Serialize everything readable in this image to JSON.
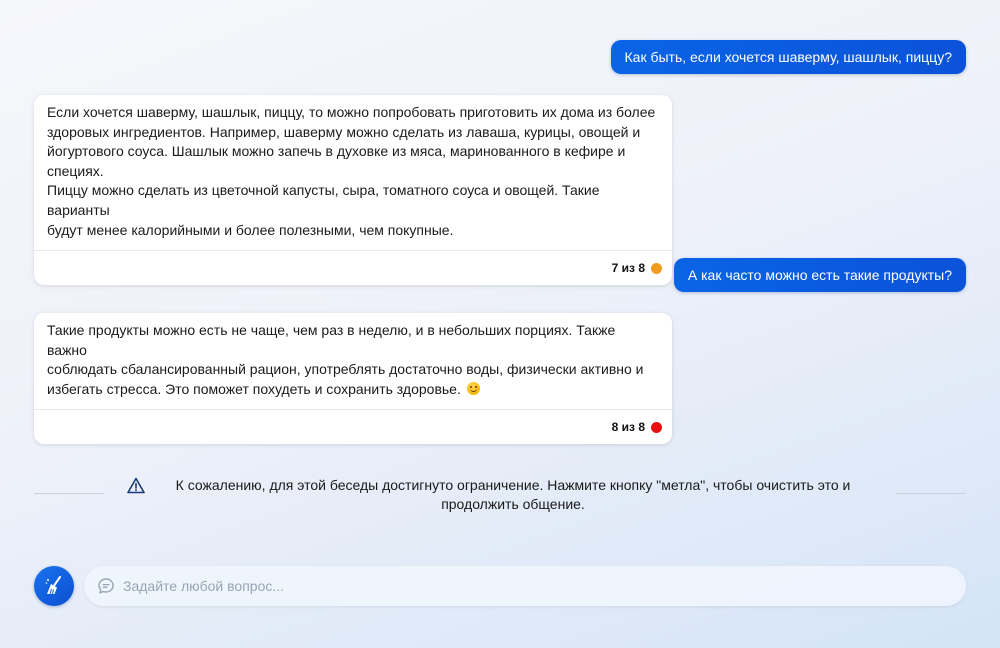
{
  "conversation": {
    "user_messages": [
      "Как быть, если хочется шаверму, шашлык, пиццу?",
      "А как часто можно есть такие продукты?"
    ],
    "bot_messages": [
      {
        "lines": [
          "Если хочется шаверму, шашлык, пиццу, то можно попробовать приготовить их дома из более",
          "здоровых ингредиентов. Например, шаверму можно сделать из лаваша, курицы, овощей и",
          "йогуртового соуса. Шашлык можно запечь в духовке из мяса, маринованного в кефире и специях.",
          "Пиццу можно сделать из цветочной капусты, сыра, томатного соуса и овощей. Такие варианты",
          "будут менее калорийными и более полезными, чем покупные."
        ],
        "counter": "7 из 8",
        "status_color": "#f29c1f"
      },
      {
        "lines": [
          "Такие продукты можно есть не чаще, чем раз в неделю, и в небольших порциях. Также важно",
          "соблюдать сбалансированный рацион, употреблять достаточно воды, физически активно и",
          "избегать стресса. Это поможет похудеть и сохранить здоровье."
        ],
        "emoji_icon": "smiling-face-emoji",
        "counter": "8 из 8",
        "status_color": "#e81010"
      }
    ]
  },
  "limit_notice": {
    "icon": "warning-triangle-icon",
    "text": "К сожалению, для этой беседы достигнуто ограничение. Нажмите кнопку \"метла\", чтобы очистить это и продолжить общение."
  },
  "composer": {
    "clear_button_icon": "broom-icon",
    "input_icon": "chat-bubble-icon",
    "placeholder": "Задайте любой вопрос..."
  },
  "colors": {
    "accent": "#0b5ee0",
    "user_bubble": "#0a64e6"
  }
}
